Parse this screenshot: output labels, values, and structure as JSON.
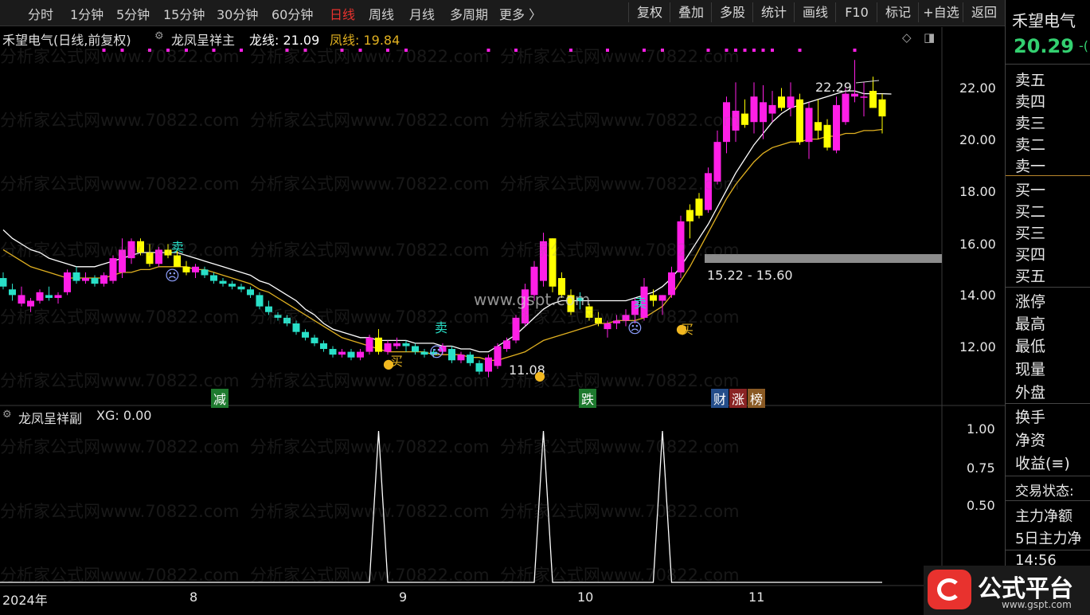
{
  "toolbar": {
    "tabs": [
      "分时",
      "1分钟",
      "5分钟",
      "15分钟",
      "30分钟",
      "60分钟",
      "日线",
      "周线",
      "月线",
      "多周期",
      "更多 〉"
    ],
    "active_tab": "日线",
    "buttons": [
      "复权",
      "叠加",
      "多股",
      "统计",
      "画线",
      "F10",
      "标记",
      "+自选",
      "返回"
    ]
  },
  "main": {
    "stock_title": "禾望电气(日线,前复权)",
    "indicator_name": "龙凤呈祥主",
    "long_line_label": "龙线: 21.09",
    "phoenix_line_label": "凤线: 19.84",
    "max_price_label": "22.29",
    "min_price_label": "11.08",
    "range_label": "15.22 - 15.60",
    "watermark_site": "www.gspt.com",
    "watermark_text": "分析家公式网www.70822.com",
    "y_ticks": [
      "22.00",
      "20.00",
      "18.00",
      "16.00",
      "14.00",
      "12.00"
    ],
    "signal_sell": "卖",
    "signal_buy": "买",
    "event_tags": [
      "减",
      "跌",
      "财",
      "涨",
      "榜"
    ]
  },
  "sub": {
    "indicator_name": "龙凤呈祥副",
    "value_label": "XG: 0.00",
    "y_ticks": [
      "1.00",
      "0.75",
      "0.50"
    ]
  },
  "x_axis": {
    "labels": [
      "2024年",
      "8",
      "9",
      "10",
      "11"
    ]
  },
  "right_panel": {
    "stock_name": "禾望电气",
    "price": "20.29",
    "price_suffix": "-(",
    "order_book": [
      "卖五",
      "卖四",
      "卖三",
      "卖二",
      "卖一",
      "买一",
      "买二",
      "买三",
      "买四",
      "买五"
    ],
    "stats": [
      "涨停",
      "最高",
      "最低",
      "现量",
      "外盘"
    ],
    "extra": [
      "换手",
      "净资",
      "收益(≡)"
    ],
    "trade_status": "交易状态:",
    "fund_items": [
      "主力净额",
      "5日主力净"
    ],
    "time": "14:56"
  },
  "brand": {
    "name": "公式平台",
    "url": "www.gspt.com"
  },
  "colors": {
    "up": "#ff1fe6",
    "down": "#29e0c8",
    "yellow": "#ffff00",
    "long_line": "#ffffff",
    "phoenix_line": "#e0b020",
    "active_tab": "#e8322e",
    "price": "#33d070"
  },
  "chart_data": {
    "type": "candlestick",
    "ylim": [
      10.5,
      23.0
    ],
    "candles": [
      {
        "o": 14.6,
        "h": 14.8,
        "l": 14.2,
        "c": 14.3,
        "k": "d"
      },
      {
        "o": 14.2,
        "h": 14.4,
        "l": 13.8,
        "c": 14.0,
        "k": "d"
      },
      {
        "o": 14.0,
        "h": 14.3,
        "l": 13.6,
        "c": 13.7,
        "k": "u"
      },
      {
        "o": 13.6,
        "h": 13.9,
        "l": 13.4,
        "c": 13.8,
        "k": "u"
      },
      {
        "o": 13.8,
        "h": 14.2,
        "l": 13.7,
        "c": 14.1,
        "k": "u"
      },
      {
        "o": 14.0,
        "h": 14.3,
        "l": 13.8,
        "c": 13.9,
        "k": "d"
      },
      {
        "o": 13.9,
        "h": 14.1,
        "l": 13.7,
        "c": 14.0,
        "k": "u"
      },
      {
        "o": 14.1,
        "h": 14.9,
        "l": 14.0,
        "c": 14.8,
        "k": "u"
      },
      {
        "o": 14.8,
        "h": 15.0,
        "l": 14.4,
        "c": 14.5,
        "k": "d"
      },
      {
        "o": 14.5,
        "h": 14.8,
        "l": 14.4,
        "c": 14.6,
        "k": "u"
      },
      {
        "o": 14.6,
        "h": 14.7,
        "l": 14.3,
        "c": 14.4,
        "k": "d"
      },
      {
        "o": 14.4,
        "h": 14.8,
        "l": 14.3,
        "c": 14.7,
        "k": "u"
      },
      {
        "o": 14.5,
        "h": 15.4,
        "l": 14.4,
        "c": 15.3,
        "k": "u"
      },
      {
        "o": 14.8,
        "h": 16.0,
        "l": 14.6,
        "c": 15.6,
        "k": "u"
      },
      {
        "o": 15.3,
        "h": 16.0,
        "l": 15.1,
        "c": 15.9,
        "k": "u"
      },
      {
        "o": 15.9,
        "h": 16.0,
        "l": 15.4,
        "c": 15.5,
        "k": "y"
      },
      {
        "o": 15.5,
        "h": 15.8,
        "l": 15.0,
        "c": 15.1,
        "k": "y"
      },
      {
        "o": 15.1,
        "h": 15.7,
        "l": 15.0,
        "c": 15.6,
        "k": "u"
      },
      {
        "o": 15.6,
        "h": 15.8,
        "l": 15.3,
        "c": 15.4,
        "k": "y"
      },
      {
        "o": 15.4,
        "h": 15.6,
        "l": 15.0,
        "c": 15.0,
        "k": "y"
      },
      {
        "o": 15.0,
        "h": 15.2,
        "l": 14.7,
        "c": 14.8,
        "k": "y"
      },
      {
        "o": 14.8,
        "h": 15.1,
        "l": 14.6,
        "c": 15.0,
        "k": "u"
      },
      {
        "o": 14.9,
        "h": 15.0,
        "l": 14.6,
        "c": 14.7,
        "k": "d"
      },
      {
        "o": 14.7,
        "h": 14.8,
        "l": 14.4,
        "c": 14.5,
        "k": "d"
      },
      {
        "o": 14.5,
        "h": 14.6,
        "l": 14.3,
        "c": 14.4,
        "k": "d"
      },
      {
        "o": 14.4,
        "h": 14.5,
        "l": 14.2,
        "c": 14.3,
        "k": "d"
      },
      {
        "o": 14.3,
        "h": 14.4,
        "l": 14.1,
        "c": 14.2,
        "k": "d"
      },
      {
        "o": 14.2,
        "h": 14.3,
        "l": 13.9,
        "c": 14.0,
        "k": "d"
      },
      {
        "o": 14.0,
        "h": 14.1,
        "l": 13.5,
        "c": 13.6,
        "k": "d"
      },
      {
        "o": 13.6,
        "h": 13.8,
        "l": 13.3,
        "c": 13.4,
        "k": "d"
      },
      {
        "o": 13.3,
        "h": 13.4,
        "l": 13.1,
        "c": 13.2,
        "k": "d"
      },
      {
        "o": 13.2,
        "h": 13.3,
        "l": 12.9,
        "c": 13.0,
        "k": "d"
      },
      {
        "o": 13.0,
        "h": 13.1,
        "l": 12.6,
        "c": 12.7,
        "k": "d"
      },
      {
        "o": 12.7,
        "h": 12.8,
        "l": 12.4,
        "c": 12.5,
        "k": "d"
      },
      {
        "o": 12.5,
        "h": 12.6,
        "l": 12.2,
        "c": 12.3,
        "k": "d"
      },
      {
        "o": 12.3,
        "h": 12.4,
        "l": 12.0,
        "c": 12.1,
        "k": "d"
      },
      {
        "o": 12.1,
        "h": 12.2,
        "l": 11.8,
        "c": 11.9,
        "k": "d"
      },
      {
        "o": 11.9,
        "h": 12.1,
        "l": 11.8,
        "c": 12.0,
        "k": "u"
      },
      {
        "o": 12.0,
        "h": 12.1,
        "l": 11.7,
        "c": 11.8,
        "k": "d"
      },
      {
        "o": 11.8,
        "h": 12.1,
        "l": 11.7,
        "c": 12.0,
        "k": "u"
      },
      {
        "o": 12.0,
        "h": 12.6,
        "l": 11.9,
        "c": 12.5,
        "k": "u"
      },
      {
        "o": 12.5,
        "h": 12.8,
        "l": 11.9,
        "c": 12.0,
        "k": "y"
      },
      {
        "o": 12.0,
        "h": 12.4,
        "l": 11.9,
        "c": 12.3,
        "k": "u"
      },
      {
        "o": 12.3,
        "h": 12.5,
        "l": 12.1,
        "c": 12.2,
        "k": "u"
      },
      {
        "o": 12.2,
        "h": 12.4,
        "l": 12.0,
        "c": 12.3,
        "k": "d"
      },
      {
        "o": 12.2,
        "h": 12.3,
        "l": 11.9,
        "c": 12.0,
        "k": "d"
      },
      {
        "o": 12.0,
        "h": 12.1,
        "l": 11.8,
        "c": 11.9,
        "k": "d"
      },
      {
        "o": 11.9,
        "h": 12.1,
        "l": 11.8,
        "c": 12.0,
        "k": "d"
      },
      {
        "o": 12.0,
        "h": 12.3,
        "l": 11.9,
        "c": 12.2,
        "k": "u"
      },
      {
        "o": 12.1,
        "h": 12.2,
        "l": 11.6,
        "c": 11.7,
        "k": "d"
      },
      {
        "o": 11.7,
        "h": 12.0,
        "l": 11.6,
        "c": 11.9,
        "k": "u"
      },
      {
        "o": 11.9,
        "h": 12.0,
        "l": 11.5,
        "c": 11.6,
        "k": "d"
      },
      {
        "o": 11.6,
        "h": 11.7,
        "l": 11.2,
        "c": 11.3,
        "k": "d"
      },
      {
        "o": 11.3,
        "h": 11.9,
        "l": 11.1,
        "c": 11.8,
        "k": "u"
      },
      {
        "o": 11.5,
        "h": 12.3,
        "l": 11.4,
        "c": 12.2,
        "k": "u"
      },
      {
        "o": 12.1,
        "h": 12.5,
        "l": 12.0,
        "c": 12.4,
        "k": "u"
      },
      {
        "o": 12.4,
        "h": 13.3,
        "l": 12.3,
        "c": 13.2,
        "k": "u"
      },
      {
        "o": 13.0,
        "h": 14.4,
        "l": 12.9,
        "c": 14.2,
        "k": "u"
      },
      {
        "o": 14.0,
        "h": 15.2,
        "l": 13.8,
        "c": 15.0,
        "k": "u"
      },
      {
        "o": 14.5,
        "h": 16.2,
        "l": 14.3,
        "c": 15.9,
        "k": "u"
      },
      {
        "o": 16.0,
        "h": 16.0,
        "l": 14.1,
        "c": 14.3,
        "k": "y"
      },
      {
        "o": 14.6,
        "h": 14.8,
        "l": 13.9,
        "c": 14.0,
        "k": "y"
      },
      {
        "o": 14.0,
        "h": 14.2,
        "l": 13.3,
        "c": 13.4,
        "k": "y"
      },
      {
        "o": 13.8,
        "h": 14.1,
        "l": 13.5,
        "c": 13.9,
        "k": "d"
      },
      {
        "o": 13.6,
        "h": 13.7,
        "l": 13.1,
        "c": 13.2,
        "k": "y"
      },
      {
        "o": 13.2,
        "h": 13.4,
        "l": 12.9,
        "c": 13.0,
        "k": "y"
      },
      {
        "o": 12.8,
        "h": 13.1,
        "l": 12.5,
        "c": 13.0,
        "k": "u"
      },
      {
        "o": 13.0,
        "h": 13.3,
        "l": 12.8,
        "c": 13.1,
        "k": "u"
      },
      {
        "o": 13.1,
        "h": 13.5,
        "l": 12.9,
        "c": 13.3,
        "k": "u"
      },
      {
        "o": 13.3,
        "h": 13.9,
        "l": 13.0,
        "c": 13.8,
        "k": "u"
      },
      {
        "o": 13.2,
        "h": 14.6,
        "l": 13.1,
        "c": 14.3,
        "k": "u"
      },
      {
        "o": 14.0,
        "h": 14.2,
        "l": 13.6,
        "c": 13.8,
        "k": "y"
      },
      {
        "o": 13.8,
        "h": 14.0,
        "l": 13.3,
        "c": 14.0,
        "k": "u"
      },
      {
        "o": 14.0,
        "h": 15.0,
        "l": 13.9,
        "c": 14.8,
        "k": "u"
      },
      {
        "o": 14.8,
        "h": 16.8,
        "l": 14.6,
        "c": 16.6,
        "k": "u"
      },
      {
        "o": 16.6,
        "h": 17.2,
        "l": 16.0,
        "c": 17.0,
        "k": "y"
      },
      {
        "o": 16.8,
        "h": 17.6,
        "l": 16.7,
        "c": 17.4,
        "k": "y"
      },
      {
        "o": 17.0,
        "h": 18.5,
        "l": 16.9,
        "c": 18.3,
        "k": "u"
      },
      {
        "o": 18.0,
        "h": 19.8,
        "l": 17.9,
        "c": 19.4,
        "k": "u"
      },
      {
        "o": 19.4,
        "h": 21.0,
        "l": 19.0,
        "c": 20.8,
        "k": "u"
      },
      {
        "o": 20.5,
        "h": 21.5,
        "l": 19.4,
        "c": 19.8,
        "k": "u"
      },
      {
        "o": 20.4,
        "h": 20.9,
        "l": 19.9,
        "c": 20.0,
        "k": "y"
      },
      {
        "o": 20.1,
        "h": 21.5,
        "l": 19.7,
        "c": 21.0,
        "k": "u"
      },
      {
        "o": 20.1,
        "h": 21.4,
        "l": 19.5,
        "c": 20.8,
        "k": "u"
      },
      {
        "o": 20.4,
        "h": 21.2,
        "l": 20.1,
        "c": 20.7,
        "k": "u"
      },
      {
        "o": 21.0,
        "h": 21.3,
        "l": 20.5,
        "c": 20.6,
        "k": "y"
      },
      {
        "o": 20.6,
        "h": 21.5,
        "l": 20.3,
        "c": 21.0,
        "k": "u"
      },
      {
        "o": 20.9,
        "h": 21.1,
        "l": 19.3,
        "c": 19.4,
        "k": "y"
      },
      {
        "o": 19.4,
        "h": 20.8,
        "l": 18.8,
        "c": 20.6,
        "k": "u"
      },
      {
        "o": 20.1,
        "h": 20.9,
        "l": 19.5,
        "c": 19.8,
        "k": "y"
      },
      {
        "o": 20.0,
        "h": 20.2,
        "l": 19.1,
        "c": 19.2,
        "k": "y"
      },
      {
        "o": 19.1,
        "h": 21.0,
        "l": 19.0,
        "c": 20.7,
        "k": "u"
      },
      {
        "o": 20.1,
        "h": 21.3,
        "l": 20.0,
        "c": 21.1,
        "k": "u"
      },
      {
        "o": 21.1,
        "h": 22.29,
        "l": 20.8,
        "c": 21.0,
        "k": "u"
      },
      {
        "o": 21.0,
        "h": 21.5,
        "l": 20.3,
        "c": 21.0,
        "k": "u"
      },
      {
        "o": 21.2,
        "h": 21.7,
        "l": 20.6,
        "c": 20.6,
        "k": "y"
      },
      {
        "o": 20.9,
        "h": 21.1,
        "l": 19.7,
        "c": 20.3,
        "k": "y"
      }
    ],
    "series": [
      {
        "name": "龙线",
        "values": [
          16.3,
          16.0,
          15.8,
          15.6,
          15.5,
          15.3,
          15.2,
          15.1,
          15.0,
          15.0,
          15.0,
          15.1,
          15.2,
          15.3,
          15.4,
          15.5,
          15.5,
          15.5,
          15.5,
          15.5,
          15.4,
          15.3,
          15.2,
          15.1,
          15.0,
          14.9,
          14.8,
          14.7,
          14.5,
          14.4,
          14.2,
          14.0,
          13.8,
          13.5,
          13.3,
          13.0,
          12.8,
          12.7,
          12.6,
          12.5,
          12.5,
          12.4,
          12.4,
          12.4,
          12.4,
          12.3,
          12.3,
          12.3,
          12.2,
          12.2,
          12.1,
          12.1,
          12.0,
          12.0,
          12.2,
          12.4,
          12.6,
          12.9,
          13.2,
          13.5,
          13.7,
          13.8,
          13.8,
          13.8,
          13.8,
          13.8,
          13.8,
          13.8,
          13.8,
          13.9,
          14.0,
          14.1,
          14.3,
          14.6,
          15.0,
          15.5,
          16.0,
          16.5,
          17.1,
          17.7,
          18.3,
          18.8,
          19.3,
          19.7,
          20.1,
          20.4,
          20.6,
          20.7,
          20.8,
          20.9,
          21.0,
          21.1,
          21.2,
          21.2,
          21.1,
          21.1,
          21.1,
          21.09
        ]
      },
      {
        "name": "凤线",
        "values": [
          15.6,
          15.4,
          15.2,
          15.0,
          14.9,
          14.8,
          14.7,
          14.6,
          14.6,
          14.6,
          14.6,
          14.6,
          14.7,
          14.8,
          14.8,
          14.9,
          14.9,
          15.0,
          15.0,
          15.0,
          15.0,
          14.9,
          14.9,
          14.8,
          14.7,
          14.6,
          14.5,
          14.4,
          14.2,
          14.1,
          13.9,
          13.7,
          13.5,
          13.3,
          13.1,
          12.9,
          12.7,
          12.5,
          12.4,
          12.3,
          12.2,
          12.1,
          12.0,
          12.0,
          12.0,
          12.0,
          12.0,
          11.9,
          11.9,
          11.9,
          11.9,
          11.8,
          11.8,
          11.7,
          11.7,
          11.8,
          11.9,
          12.0,
          12.2,
          12.4,
          12.5,
          12.6,
          12.7,
          12.8,
          12.9,
          13.0,
          13.0,
          13.1,
          13.1,
          13.1,
          13.2,
          13.4,
          13.6,
          14.0,
          14.5,
          15.0,
          15.6,
          16.2,
          16.8,
          17.4,
          17.9,
          18.3,
          18.7,
          19.0,
          19.2,
          19.3,
          19.4,
          19.4,
          19.5,
          19.5,
          19.6,
          19.6,
          19.7,
          19.7,
          19.8,
          19.8,
          19.84
        ]
      }
    ],
    "sub_chart": {
      "name": "XG",
      "ylim": [
        0,
        1.0
      ],
      "spikes_at": [
        41,
        59,
        72
      ],
      "values_note": ""
    }
  }
}
